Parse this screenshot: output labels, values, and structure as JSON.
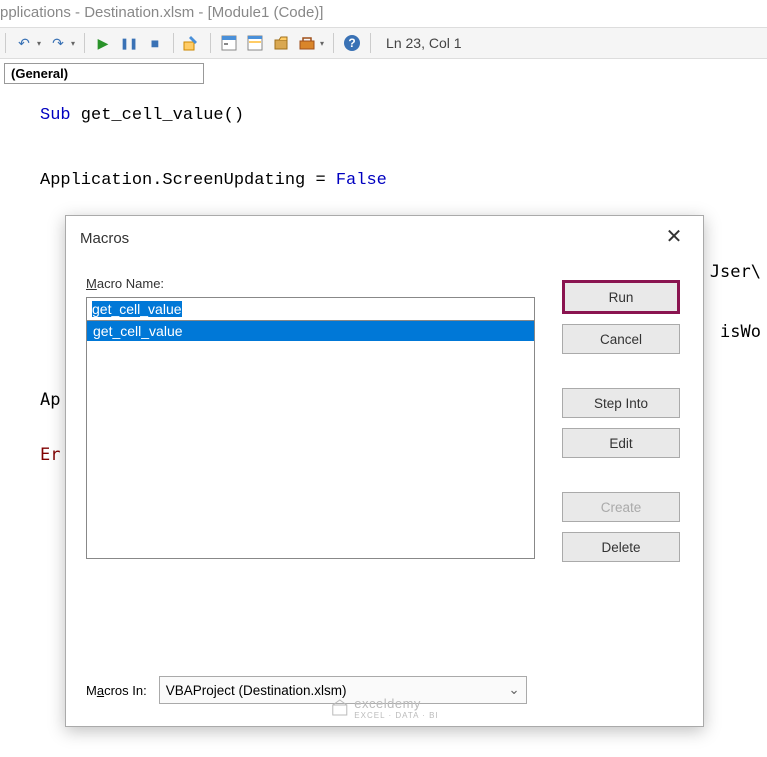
{
  "title": "pplications - Destination.xlsm - [Module1 (Code)]",
  "cursor_position": "Ln 23, Col 1",
  "toolbar": {
    "icons": [
      "undo",
      "redo",
      "run",
      "pause",
      "stop",
      "design",
      "project-explorer",
      "properties",
      "object-browser",
      "toolbox",
      "references",
      "help"
    ]
  },
  "general_dropdown": "(General)",
  "code": {
    "sub_kw": "Sub",
    "sub_name": " get_cell_value()",
    "line2a": "Application.ScreenUpdating = ",
    "false_kw": "False",
    "partial_right_1": "Jser\\",
    "partial_right_2": "isWo",
    "ap_partial": "Ap",
    "er_partial": "Er"
  },
  "dialog": {
    "title": "Macros",
    "macro_name_label": "Macro Name:",
    "macro_name_value": "get_cell_value",
    "macro_list": [
      "get_cell_value"
    ],
    "buttons": {
      "run": "Run",
      "cancel": "Cancel",
      "step_into": "Step Into",
      "edit": "Edit",
      "create": "Create",
      "delete": "Delete"
    },
    "macros_in_label": "Macros In:",
    "macros_in_value": "VBAProject (Destination.xlsm)"
  },
  "watermark": {
    "brand": "exceldemy",
    "tagline": "EXCEL · DATA · BI"
  }
}
